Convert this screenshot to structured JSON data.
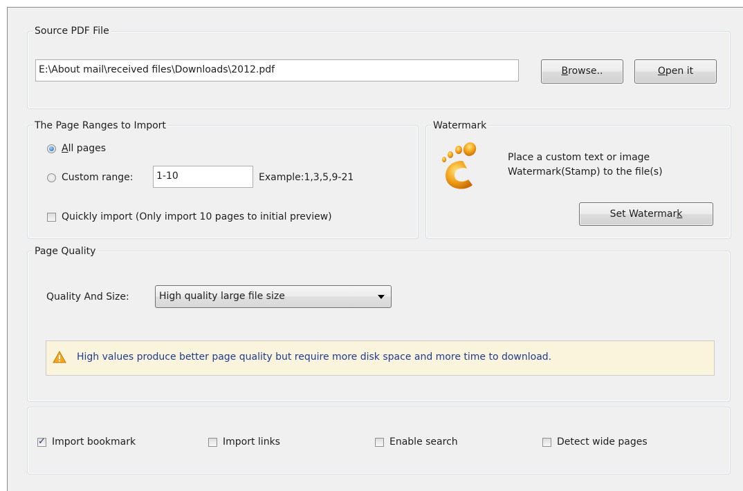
{
  "source": {
    "legend": "Source PDF File",
    "path_value": "E:\\About mail\\received files\\Downloads\\2012.pdf",
    "browse_label": "Browse..",
    "browse_mnemonic": "B",
    "open_label": "Open it",
    "open_mnemonic": "O"
  },
  "ranges": {
    "legend": "The Page Ranges to Import",
    "all_pages_label": "All pages",
    "all_pages_mnemonic": "A",
    "all_pages_checked": true,
    "custom_label": "Custom range:",
    "custom_checked": false,
    "custom_value": "1-10",
    "example_text": "Example:1,3,5,9-21",
    "quick_label": "Quickly import (Only import 10 pages to  initial  preview)",
    "quick_checked": false
  },
  "watermark": {
    "legend": "Watermark",
    "icon": "watermark-footprint-icon",
    "description_line1": "Place a custom text or image",
    "description_line2": "Watermark(Stamp) to the file(s)",
    "button_label": "Set Watermark",
    "button_mnemonic": "k"
  },
  "quality": {
    "legend": "Page Quality",
    "size_label": "Quality And Size:",
    "selected": "High quality large file size",
    "warning_icon": "warning-triangle-icon",
    "warning_text": "High values produce better page quality but require more disk space and more time to download.",
    "warning_color": "#1f3a93"
  },
  "options": [
    {
      "label": "Import bookmark",
      "checked": true
    },
    {
      "label": "Import links",
      "checked": false
    },
    {
      "label": "Enable search",
      "checked": false
    },
    {
      "label": "Detect wide pages",
      "checked": false
    }
  ]
}
